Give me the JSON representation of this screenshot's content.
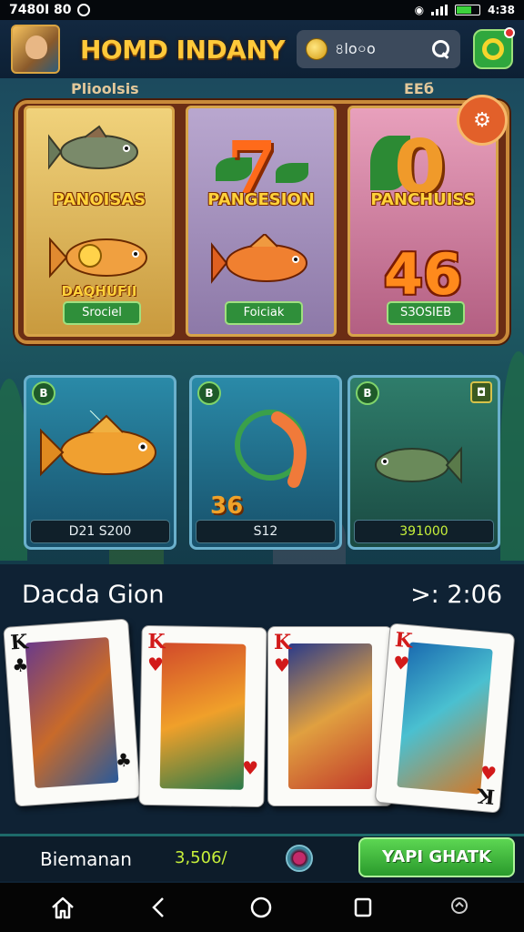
{
  "status_bar": {
    "left_text": "7480I 80",
    "time": "4:38"
  },
  "header": {
    "title": "HOMD INDANY",
    "search_value": "৪lo০o"
  },
  "banner": {
    "label_left": "Plioolsis",
    "label_right": "ЕЕб",
    "slots": [
      {
        "name": "PANOISAS",
        "sub": "DAQHUFII",
        "button": "Srociel"
      },
      {
        "name": "PANGESION",
        "button": "Foiciak"
      },
      {
        "name": "PANCHUISS",
        "big": "46",
        "button": "SЗOSIEB"
      }
    ]
  },
  "tiles": [
    {
      "value": "D21 S200",
      "corner": "B"
    },
    {
      "value": "S12",
      "corner": "B",
      "number": "36"
    },
    {
      "value": "391000",
      "corner": "B"
    }
  ],
  "lower": {
    "title": "Dacda Gion",
    "timer": ">: 2:06"
  },
  "cards": [
    {
      "rank": "K",
      "suit": "♣"
    },
    {
      "rank": "K",
      "suit": "♥"
    },
    {
      "rank": "K",
      "suit": "♥"
    },
    {
      "rank": "K",
      "suit": "♥"
    }
  ],
  "action_bar": {
    "player_name": "Biemanan",
    "balance": "3,506/",
    "go_button": "YAPI GHATK"
  },
  "colors": {
    "title": "#ffc93a",
    "balance": "#c7f03a",
    "go_button": "#3cb63c",
    "card_red": "#d21a1a"
  },
  "icons": {
    "header": [
      "avatar",
      "coin-icon",
      "search-icon",
      "settings-icon"
    ],
    "nav": [
      "home-icon",
      "back-icon",
      "home-circle-icon",
      "recent-apps-icon",
      "gallery-icon"
    ]
  }
}
